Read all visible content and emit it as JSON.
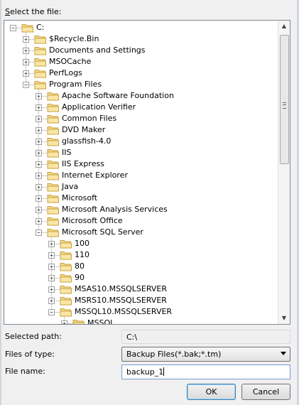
{
  "dialog": {
    "select_label": "Select the file:",
    "select_accel": "S",
    "select_rest": "elect the file:",
    "selected_path_label": "Selected path:",
    "selected_path_value": "C:\\",
    "files_of_type_label": "Files of type:",
    "files_of_type_value": "Backup Files(*.bak;*.tm)",
    "file_name_label": "File name:",
    "file_name_value": "backup_1",
    "ok_label": "OK",
    "cancel_label": "Cancel"
  },
  "tree": {
    "items": [
      {
        "label": "C:",
        "depth": 0,
        "expanded": true
      },
      {
        "label": "$Recycle.Bin",
        "depth": 1,
        "expanded": false
      },
      {
        "label": "Documents and Settings",
        "depth": 1,
        "expanded": false
      },
      {
        "label": "MSOCache",
        "depth": 1,
        "expanded": false
      },
      {
        "label": "PerfLogs",
        "depth": 1,
        "expanded": false
      },
      {
        "label": "Program Files",
        "depth": 1,
        "expanded": true
      },
      {
        "label": "Apache Software Foundation",
        "depth": 2,
        "expanded": false
      },
      {
        "label": "Application Verifier",
        "depth": 2,
        "expanded": false
      },
      {
        "label": "Common Files",
        "depth": 2,
        "expanded": false
      },
      {
        "label": "DVD Maker",
        "depth": 2,
        "expanded": false
      },
      {
        "label": "glassfish-4.0",
        "depth": 2,
        "expanded": false
      },
      {
        "label": "IIS",
        "depth": 2,
        "expanded": false
      },
      {
        "label": "IIS Express",
        "depth": 2,
        "expanded": false
      },
      {
        "label": "Internet Explorer",
        "depth": 2,
        "expanded": false
      },
      {
        "label": "Java",
        "depth": 2,
        "expanded": false
      },
      {
        "label": "Microsoft",
        "depth": 2,
        "expanded": false
      },
      {
        "label": "Microsoft Analysis Services",
        "depth": 2,
        "expanded": false
      },
      {
        "label": "Microsoft Office",
        "depth": 2,
        "expanded": false
      },
      {
        "label": "Microsoft SQL Server",
        "depth": 2,
        "expanded": true
      },
      {
        "label": "100",
        "depth": 3,
        "expanded": false
      },
      {
        "label": "110",
        "depth": 3,
        "expanded": false
      },
      {
        "label": "80",
        "depth": 3,
        "expanded": false
      },
      {
        "label": "90",
        "depth": 3,
        "expanded": false
      },
      {
        "label": "MSAS10.MSSQLSERVER",
        "depth": 3,
        "expanded": false
      },
      {
        "label": "MSRS10.MSSQLSERVER",
        "depth": 3,
        "expanded": false
      },
      {
        "label": "MSSQL10.MSSQLSERVER",
        "depth": 3,
        "expanded": true
      },
      {
        "label": "MSSQL",
        "depth": 4,
        "expanded": false
      }
    ]
  },
  "colors": {
    "folder_fill": "#f3d98a",
    "folder_stroke": "#c9a23f"
  },
  "icons": {
    "folder": "folder-icon",
    "expander": "expander-icon",
    "scroll_up": "scroll-up-arrow-icon",
    "scroll_down": "scroll-down-arrow-icon",
    "dropdown": "chevron-down-icon"
  }
}
